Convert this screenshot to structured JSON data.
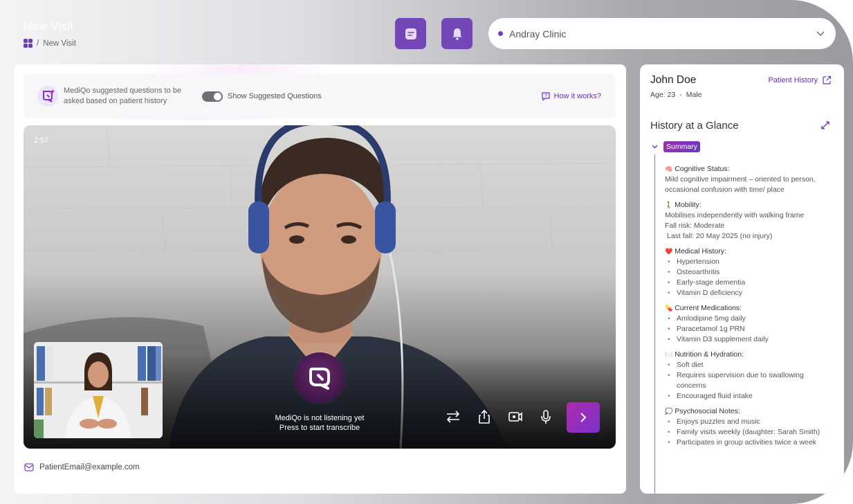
{
  "header": {
    "title": "New Visit",
    "breadcrumb_current": "New Visit",
    "clinic": "Andray Clinic"
  },
  "suggestion_bar": {
    "text": "MediQo suggested questions to be asked based on patient history",
    "toggle_label": "Show Suggested Questions",
    "toggle_on": true,
    "help_link": "How it works?"
  },
  "video": {
    "timer": "2:57",
    "status_line1": "MediQo is not listening yet",
    "status_line2": "Press to start transcribe"
  },
  "email": "PatientEmail@example.com",
  "patient": {
    "name": "John Doe",
    "age": "Age: 23",
    "separator": "-",
    "sex": "Male",
    "history_link": "Patient History"
  },
  "glance": {
    "title": "History at a Glance",
    "badge": "Summary",
    "sections": {
      "cognitive": {
        "emoji": "🧠",
        "title": "Cognitive Status:",
        "text": "Mild cognitive impairment – oriented to person, occasional confusion with time/ place"
      },
      "mobility": {
        "emoji": "🚶",
        "title": "Mobility:",
        "line1": "Mobilises independently with walking frame",
        "line2": "Fall risk: Moderate",
        "line3": "Last fall: 20 May 2025 (no injury)"
      },
      "medical": {
        "emoji": "❤️",
        "title": "Medical History:",
        "items": [
          "Hypertension",
          "Osteoarthritis",
          "Early-stage dementia",
          "Vitamin D deficiency"
        ]
      },
      "medications": {
        "emoji": "💊",
        "title": "Current Medications:",
        "items": [
          "Amlodipine 5mg daily",
          "Paracetamol 1g PRN",
          "Vitamin D3 supplement daily"
        ]
      },
      "nutrition": {
        "emoji": "🍽️",
        "title": "Nutrition & Hydration:",
        "items": [
          "Soft diet",
          "Requires supervision due to swallowing concerns",
          "Encouraged fluid intake"
        ]
      },
      "psychosocial": {
        "emoji": "💭",
        "title": "Psychosocial Notes:",
        "items": [
          "Enjoys puzzles and music",
          "Family visits weekly (daughter: Sarah Smith)",
          "Participates in group activities twice a week"
        ]
      }
    }
  },
  "colors": {
    "brand": "#7447b8",
    "accent_link": "#6b2fbf",
    "next_gradient_start": "#b02ab0",
    "next_gradient_end": "#7a32c8"
  }
}
